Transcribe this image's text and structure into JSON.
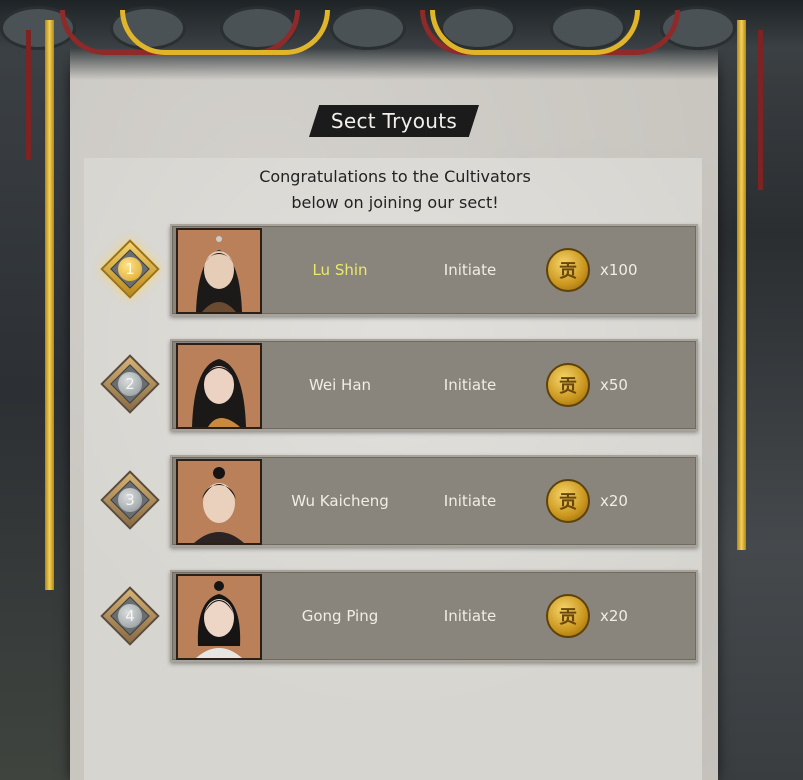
{
  "dialog": {
    "title": "Sect Tryouts",
    "subtitle_line1": "Congratulations to the Cultivators",
    "subtitle_line2": "below on joining our sect!"
  },
  "recruits": [
    {
      "rank": "1",
      "name": "Lu Shin",
      "title": "Initiate",
      "reward_icon": "贡",
      "reward": "x100",
      "highlight": true
    },
    {
      "rank": "2",
      "name": "Wei Han",
      "title": "Initiate",
      "reward_icon": "贡",
      "reward": "x50",
      "highlight": false
    },
    {
      "rank": "3",
      "name": "Wu Kaicheng",
      "title": "Initiate",
      "reward_icon": "贡",
      "reward": "x20",
      "highlight": false
    },
    {
      "rank": "4",
      "name": "Gong Ping",
      "title": "Initiate",
      "reward_icon": "贡",
      "reward": "x20",
      "highlight": false
    }
  ],
  "colors": {
    "highlight_name": "#e9ea69",
    "gold_trim": "#e0b52a",
    "row_bg": "#8a857c"
  }
}
